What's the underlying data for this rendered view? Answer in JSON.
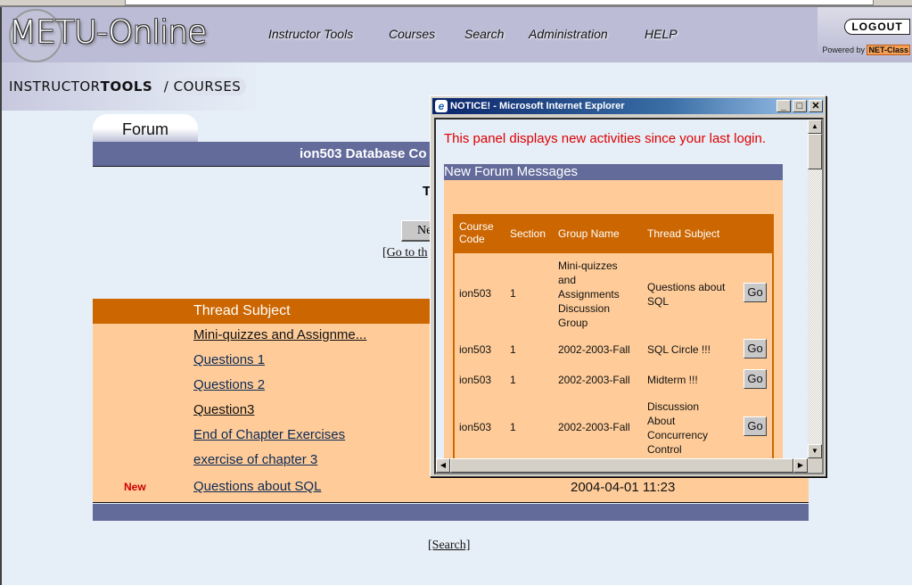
{
  "header": {
    "logo": "METU-Online",
    "nav": [
      "Instructor Tools",
      "Courses",
      "Search",
      "Administration",
      "HELP"
    ],
    "logout": "LOGOUT",
    "powered_by": "Powered by",
    "brand": "NET-Class"
  },
  "breadcrumb": {
    "part1": "INSTRUCTOR",
    "part2": "TOOLS",
    "separator": "/",
    "part3": "COURSES"
  },
  "forum": {
    "tab_label": "Forum",
    "course_title": "ion503 Database Co",
    "heading_partial": "T",
    "new_button_partial": "Ne",
    "goto_link_partial": "[Go to th",
    "table_header": "Thread Subject",
    "threads": [
      {
        "subject": "Mini-quizzes and Assignme...",
        "new": "",
        "date": "",
        "visited": true
      },
      {
        "subject": "Questions 1",
        "new": "",
        "date": "",
        "visited": false
      },
      {
        "subject": "Questions 2",
        "new": "",
        "date": "",
        "visited": false
      },
      {
        "subject": "Question3",
        "new": "",
        "date": "",
        "visited": true
      },
      {
        "subject": "End of Chapter Exercises",
        "new": "",
        "date": "",
        "visited": false
      },
      {
        "subject": "exercise of chapter 3",
        "new": "",
        "date": "",
        "visited": false
      },
      {
        "subject": "Questions about SQL",
        "new": "New",
        "date": "2004-04-01 11:23",
        "visited": false
      }
    ],
    "search_link": "[Search]"
  },
  "popup": {
    "title": "NOTICE! - Microsoft Internet Explorer",
    "notice": "This panel displays new activities since your last login.",
    "section_title": "New Forum Messages",
    "columns": [
      "Course Code",
      "Section",
      "Group Name",
      "Thread Subject"
    ],
    "go_label": "Go",
    "rows": [
      {
        "course": "ion503",
        "section": "1",
        "group": "Mini-quizzes and Assignments Discussion Group",
        "subject": "Questions about SQL"
      },
      {
        "course": "ion503",
        "section": "1",
        "group": "2002-2003-Fall",
        "subject": "SQL Circle !!!"
      },
      {
        "course": "ion503",
        "section": "1",
        "group": "2002-2003-Fall",
        "subject": "Midterm !!!"
      },
      {
        "course": "ion503",
        "section": "1",
        "group": "2002-2003-Fall",
        "subject": "Discussion About Concurrency Control"
      }
    ]
  }
}
